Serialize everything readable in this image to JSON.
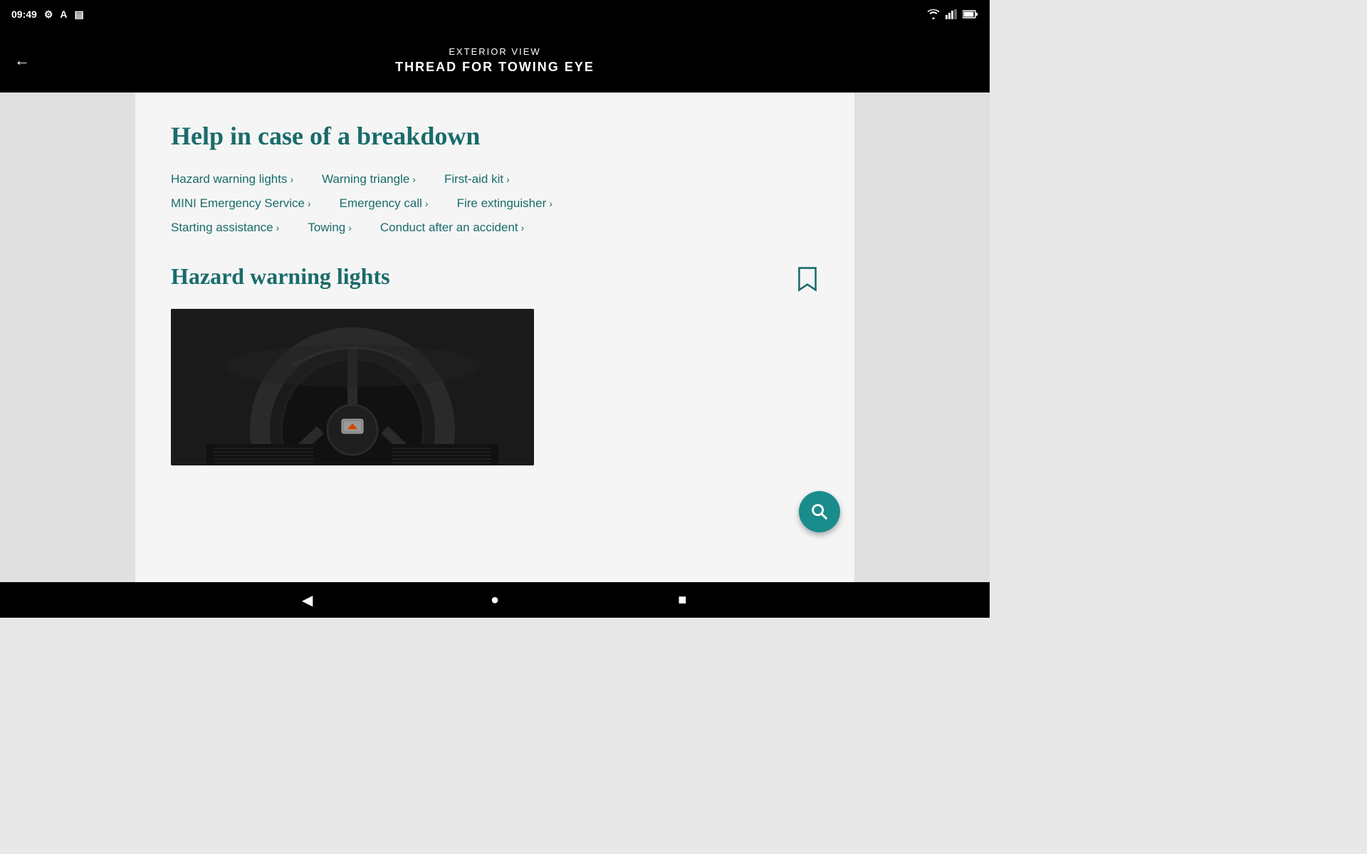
{
  "statusBar": {
    "time": "09:49",
    "icons": [
      "settings",
      "accessibility",
      "battery-saver"
    ]
  },
  "topNav": {
    "subtitle": "EXTERIOR VIEW",
    "title": "THREAD FOR TOWING EYE",
    "backLabel": "←"
  },
  "helpSection": {
    "title": "Help in case of a breakdown",
    "links": [
      [
        {
          "label": "Hazard warning lights",
          "hasChevron": true
        },
        {
          "label": "Warning triangle",
          "hasChevron": true
        },
        {
          "label": "First-aid kit",
          "hasChevron": true
        }
      ],
      [
        {
          "label": "MINI Emergency Service",
          "hasChevron": true
        },
        {
          "label": "Emergency call",
          "hasChevron": true
        },
        {
          "label": "Fire extinguisher",
          "hasChevron": true
        }
      ],
      [
        {
          "label": "Starting assistance",
          "hasChevron": true
        },
        {
          "label": "Towing",
          "hasChevron": true
        },
        {
          "label": "Conduct after an accident",
          "hasChevron": true
        }
      ]
    ]
  },
  "hazardSection": {
    "title": "Hazard warning lights"
  },
  "bottomNav": {
    "back": "◀",
    "home": "●",
    "recent": "■"
  },
  "searchFab": {
    "label": "Search"
  }
}
